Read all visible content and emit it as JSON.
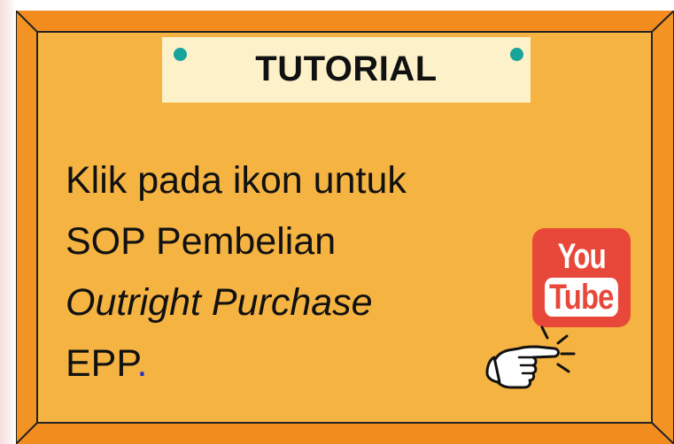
{
  "banner": {
    "title": "TUTORIAL"
  },
  "message": {
    "line1": "Klik pada ikon untuk",
    "line2": "SOP Pembelian",
    "line3": "Outright Purchase",
    "line4": "EPP",
    "line4_punct": "."
  },
  "youtube": {
    "word_top": "You",
    "word_bottom": "Tube"
  },
  "colors": {
    "board_fill": "#f5b342",
    "board_border": "#f39324",
    "title_panel": "#fdf1c9",
    "pin": "#18a39b",
    "youtube_red": "#e8483a"
  },
  "icons": [
    "pushpin-icon",
    "youtube-icon",
    "pointing-hand-icon"
  ]
}
